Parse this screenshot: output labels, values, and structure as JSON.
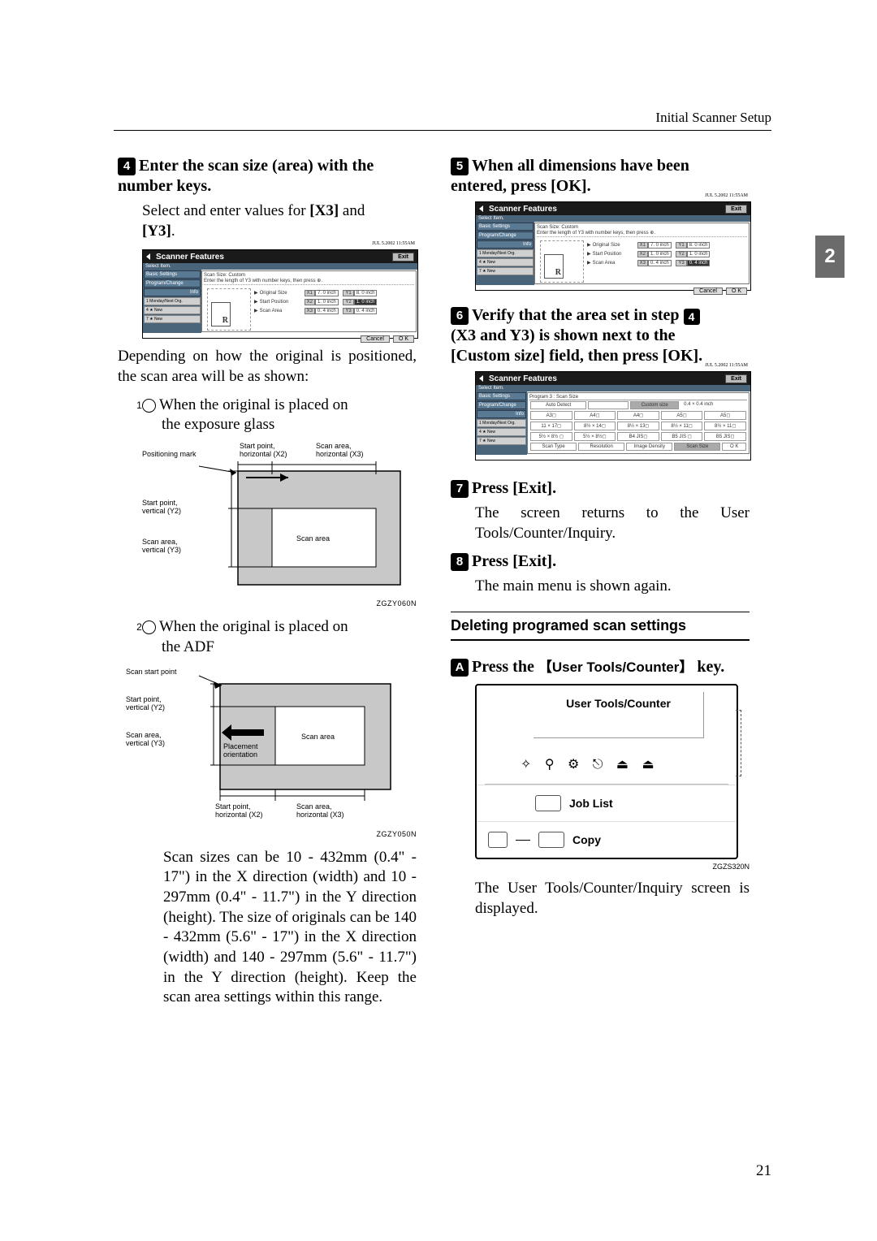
{
  "header": {
    "section": "Initial Scanner Setup"
  },
  "pageTab": "2",
  "pageNumber": "21",
  "left": {
    "step4": {
      "num": "4",
      "title_a": "Enter the scan size (area) with the",
      "title_b": "number keys.",
      "body_a": "Select and enter values for ",
      "kbd1": "[X3]",
      "body_b": " and ",
      "kbd2": "[Y3]",
      "body_c": "."
    },
    "scr4": {
      "clock": "JUL   5.2002 11:55AM",
      "title": "Scanner Features",
      "exit": "Exit",
      "selectItem": "Select Item.",
      "side": {
        "basic": "Basic Settings",
        "prog": "Program/Change",
        "info": "Info",
        "r1": "1  Monday/Next Org.",
        "r4": "4  ★ New",
        "r7": "7  ★ New"
      },
      "scanSize": "Scan Size: Custom",
      "instr": "Enter the length of Y3 with number keys, then press ⊕.",
      "labels": {
        "orig": "Original Size",
        "start": "Start Position",
        "area": "Scan Area"
      },
      "vals": {
        "x1l": "X1",
        "x1v": "7. 0 inch",
        "y1l": "Y1",
        "y1v": "8. 0 inch",
        "x2l": "X2",
        "x2v": "1. 0 inch",
        "y2l": "Y2",
        "y2v": "1. 0 inch",
        "x3l": "X3",
        "x3v": "0. 4 inch",
        "y3l": "Y3",
        "y3v": "0. 4 inch"
      },
      "cancel": "Cancel",
      "ok": "O K"
    },
    "explain": "Depending on how the original is positioned, the scan area will be as shown:",
    "sub1": {
      "num": "1",
      "text_a": "When the original is placed on",
      "text_b": "the exposure glass"
    },
    "diag1": {
      "posMark": "Positioning mark",
      "startH": "Start point,\nhorizontal (X2)",
      "scanH": "Scan area,\nhorizontal (X3)",
      "startV": "Start point,\nvertical (Y2)",
      "scanV": "Scan area,\nvertical (Y3)",
      "area": "Scan area",
      "id": "ZGZY060N"
    },
    "sub2": {
      "num": "2",
      "text_a": "When the original is placed on",
      "text_b": "the ADF"
    },
    "diag2": {
      "scanStart": "Scan start point",
      "startV": "Start point,\nvertical (Y2)",
      "scanV": "Scan area,\nvertical (Y3)",
      "place": "Placement\norientation",
      "area": "Scan area",
      "startH": "Start point,\nhorizontal (X2)",
      "scanH": "Scan area,\nhorizontal (X3)",
      "id": "ZGZY050N"
    },
    "range": "Scan sizes can be 10 - 432mm (0.4\" - 17\") in the X direction (width) and 10 - 297mm (0.4\" - 11.7\") in the Y direction (height). The size of originals can be 140 - 432mm (5.6\" - 17\") in the X direction (width) and 140 - 297mm (5.6\" - 11.7\") in the Y direction (height). Keep the scan area settings within this range."
  },
  "right": {
    "step5": {
      "num": "5",
      "title_a": "When all dimensions have been",
      "title_b": "entered, press ",
      "kbd": "[OK]",
      "title_c": "."
    },
    "scr5": {
      "clock": "JUL   5.2002 11:55AM",
      "title": "Scanner Features",
      "exit": "Exit",
      "selectItem": "Select Item.",
      "side": {
        "basic": "Basic Settings",
        "prog": "Program/Change",
        "info": "Info",
        "r1": "1  Monday/Next Org.",
        "r4": "4  ★ New",
        "r7": "7  ★ New"
      },
      "scanSize": "Scan Size: Custom",
      "instr": "Enter the length of Y3 with number keys, then press ⊕.",
      "labels": {
        "orig": "Original Size",
        "start": "Start Position",
        "area": "Scan Area"
      },
      "vals": {
        "x1l": "X1",
        "x1v": "7. 0 inch",
        "y1l": "Y1",
        "y1v": "8. 0 inch",
        "x2l": "X2",
        "x2v": "1. 0 inch",
        "y2l": "Y2",
        "y2v": "1. 0 inch",
        "x3l": "X3",
        "x3v": "0. 4 inch",
        "y3l": "Y3",
        "y3v": "0. 4 inch"
      },
      "cancel": "Cancel",
      "ok": "O K"
    },
    "step6": {
      "num": "6",
      "title_a": "Verify that the area set in step ",
      "refnum": "4",
      "title_b": "(X3 and Y3) is shown next to the ",
      "kbd": "[Custom size]",
      "title_c": " field, then press ",
      "kbd2": "[OK]",
      "title_d": "."
    },
    "scr6": {
      "clock": "JUL   5.2002 11:55AM",
      "title": "Scanner Features",
      "exit": "Exit",
      "selectItem": "Select Item.",
      "side": {
        "basic": "Basic Settings",
        "prog": "Program/Change",
        "info": "Info",
        "r1": "1  Monday/Next Org.",
        "r4": "4  ★ New",
        "r7": "7  ★ New"
      },
      "header": "Program 3 : Scan Size",
      "custom": "Custom size",
      "customVal": "0.4 × 0.4 inch",
      "auto": "Auto Detect",
      "grid": {
        "r1": [
          "A3◻",
          "A4◻",
          "A4◻",
          "A5◻",
          "A5◻"
        ],
        "r2": [
          "11 × 17◻",
          "8½ × 14◻",
          "8½ × 13◻",
          "8½ × 11◻",
          "8½ × 11◻"
        ],
        "r3": [
          "5½ × 8½ ◻",
          "5½ × 8½◻",
          "B4 JIS◻",
          "B5 JIS ◻",
          "B5 JIS◻"
        ],
        "r4": [
          "Scan Type",
          "Resolution",
          "Image Density",
          "Scan Size"
        ]
      },
      "ok": "O K"
    },
    "step7": {
      "num": "7",
      "title": "Press ",
      "kbd": "[Exit]",
      "title_c": ".",
      "body": "The screen returns to the User Tools/Counter/Inquiry."
    },
    "step8": {
      "num": "8",
      "title": "Press ",
      "kbd": "[Exit]",
      "title_c": ".",
      "body": "The main menu is shown again."
    },
    "sectionTitle": "Deleting programed scan settings",
    "stepA": {
      "num": "A",
      "title": "Press the ",
      "kbd": "【User Tools/Counter】",
      "title_c": " key."
    },
    "utc": {
      "top": "User Tools/Counter",
      "icons": "✧ ⚲ ⚙ ⎋ ⏏ ⏏",
      "job": "Job List",
      "copy": "Copy",
      "id": "ZGZS320N"
    },
    "afterA": "The User Tools/Counter/Inquiry screen is displayed."
  }
}
